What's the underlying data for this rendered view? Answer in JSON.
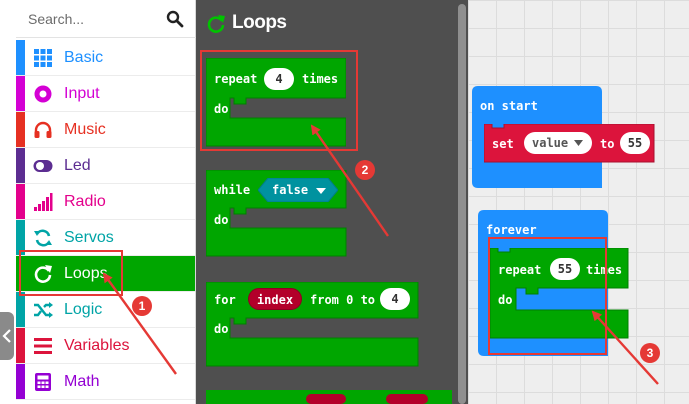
{
  "search": {
    "placeholder": "Search..."
  },
  "categories": [
    {
      "label": "Basic",
      "color": "#1e90ff",
      "icon": "grid-icon"
    },
    {
      "label": "Input",
      "color": "#d400d4",
      "icon": "radio-button-icon"
    },
    {
      "label": "Music",
      "color": "#e63022",
      "icon": "headphones-icon"
    },
    {
      "label": "Led",
      "color": "#5c2d91",
      "icon": "toggle-icon"
    },
    {
      "label": "Radio",
      "color": "#e3008c",
      "icon": "signal-bars-icon"
    },
    {
      "label": "Servos",
      "color": "#00a4a6",
      "icon": "refresh-icon"
    },
    {
      "label": "Loops",
      "color": "#00aa00",
      "icon": "loop-icon",
      "selected": true
    },
    {
      "label": "Logic",
      "color": "#00a4a6",
      "icon": "shuffle-icon"
    },
    {
      "label": "Variables",
      "color": "#dc143c",
      "icon": "list-icon"
    },
    {
      "label": "Math",
      "color": "#9400d3",
      "icon": "calculator-icon"
    }
  ],
  "flyout": {
    "title": "Loops",
    "repeat_block": {
      "kw": "repeat",
      "count": "4",
      "suffix": "times",
      "do": "do"
    },
    "while_block": {
      "kw": "while",
      "cond": "false",
      "do": "do"
    },
    "for_block": {
      "kw": "for",
      "var": "index",
      "mid": "from 0 to",
      "end": "4",
      "do": "do"
    }
  },
  "workspace": {
    "on_start": {
      "label": "on start",
      "set_kw": "set",
      "var": "value",
      "to": "to",
      "val": "55"
    },
    "forever": {
      "label": "forever",
      "repeat_kw": "repeat",
      "count": "55",
      "suffix": "times",
      "do": "do"
    }
  },
  "annotations": {
    "badge1": "1",
    "badge2": "2",
    "badge3": "3"
  },
  "colors": {
    "loops_green": "#00a600",
    "event_blue": "#1e90ff",
    "variables_red": "#dc143c",
    "logic_teal": "#00929f",
    "annotation_red": "#e53935"
  }
}
